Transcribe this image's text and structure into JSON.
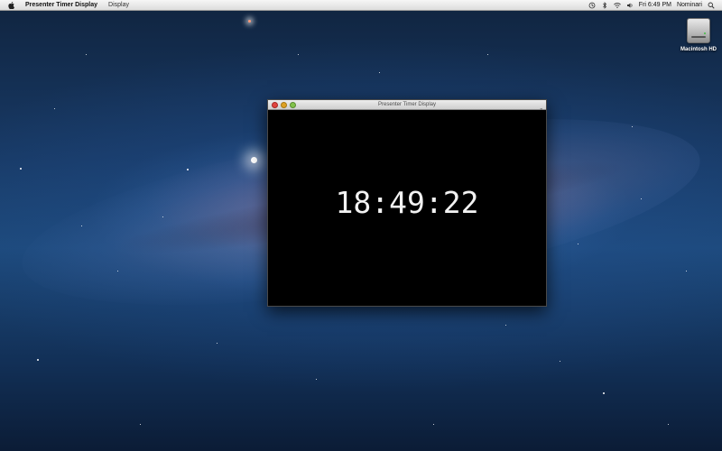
{
  "menubar": {
    "apple_icon": "apple-icon",
    "app_name": "Presenter Timer Display",
    "menus": [
      "Display"
    ],
    "status": {
      "time_machine_icon": "time-machine-icon",
      "bluetooth_icon": "bluetooth-icon",
      "wifi_icon": "wifi-icon",
      "volume_icon": "volume-icon",
      "clock": "Fri 6:49 PM",
      "user": "Nominari",
      "search_icon": "spotlight-search-icon"
    }
  },
  "desktop": {
    "drive_label": "Macintosh HD",
    "drive_icon": "hard-drive-icon"
  },
  "window": {
    "title": "Presenter Timer Display",
    "timer": "18:49:22",
    "colors": {
      "background": "#000000",
      "text": "#f2f2f2",
      "close": "#e0443e",
      "minimize": "#dea123",
      "zoom": "#82c24b"
    }
  }
}
